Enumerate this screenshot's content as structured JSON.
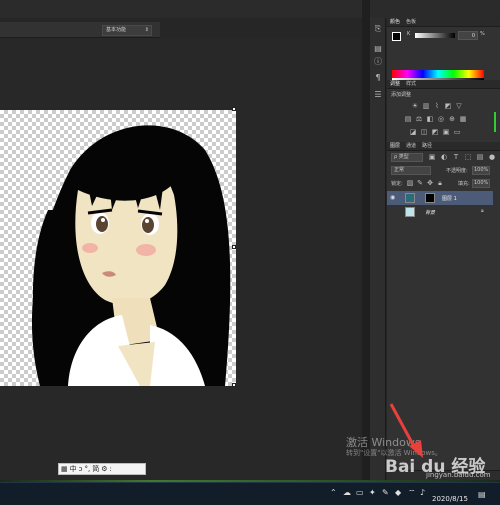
{
  "options_bar": {
    "workspace": "基本功能"
  },
  "color_panel": {
    "tabs": [
      "颜色",
      "色板"
    ],
    "channel": "K",
    "value": "0",
    "unit": "%"
  },
  "adjustments_panel": {
    "tabs": [
      "调整",
      "样式"
    ],
    "subtitle": "添加调整"
  },
  "layers_panel": {
    "tabs": [
      "图层",
      "通道",
      "路径"
    ],
    "kind_filter": "ρ 类型",
    "blend_mode": "正常",
    "opacity_label": "不透明度:",
    "opacity_value": "100%",
    "lock_label": "锁定:",
    "fill_label": "填充:",
    "fill_value": "100%",
    "layers": [
      {
        "name": "图层 1",
        "selected": true
      },
      {
        "name": "背景",
        "selected": false
      }
    ]
  },
  "ime_toolbar": {
    "items": [
      "中",
      "ɔ",
      "°,",
      "简",
      "⚙",
      ":"
    ]
  },
  "watermark": {
    "title": "激活 Windows",
    "subtitle": "转到\"设置\"以激活 Windows。"
  },
  "brand": {
    "logo": "Bai du 经验",
    "url": "jingyan.baidu.com"
  },
  "taskbar": {
    "date": "2020/8/15"
  },
  "colors": {
    "arrow": "#e8403a",
    "selected_layer": "#4b5b78",
    "taskbar": "#121d2a"
  }
}
